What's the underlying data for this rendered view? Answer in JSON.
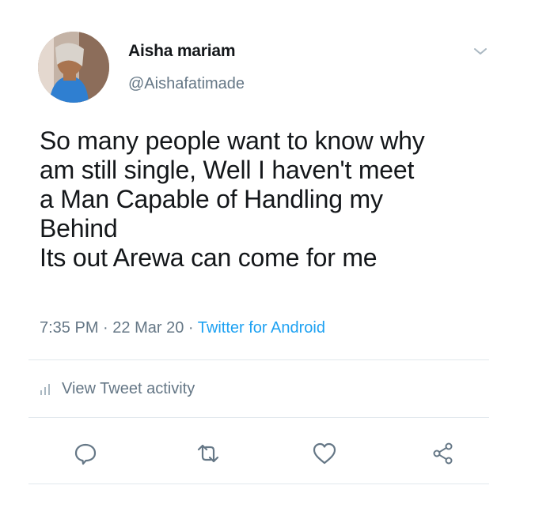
{
  "author": {
    "name": "Aisha mariam",
    "handle": "@Aishafatimade"
  },
  "tweet": {
    "text": "So many people want to know why\nam still single, Well I haven't meet\na Man Capable of Handling my\nBehind\nIts out Arewa can come for me",
    "time": "7:35 PM",
    "date": "22 Mar 20",
    "separator": "·",
    "source": "Twitter for Android"
  },
  "activity": {
    "label": "View Tweet activity",
    "icon": "bar-chart-icon"
  },
  "actions": [
    {
      "name": "reply",
      "icon": "reply-icon"
    },
    {
      "name": "retweet",
      "icon": "retweet-icon"
    },
    {
      "name": "like",
      "icon": "heart-icon"
    },
    {
      "name": "share",
      "icon": "share-icon"
    }
  ],
  "colors": {
    "text": "#14171a",
    "muted": "#657786",
    "link": "#1da1f2",
    "divider": "#e1e8ed"
  }
}
